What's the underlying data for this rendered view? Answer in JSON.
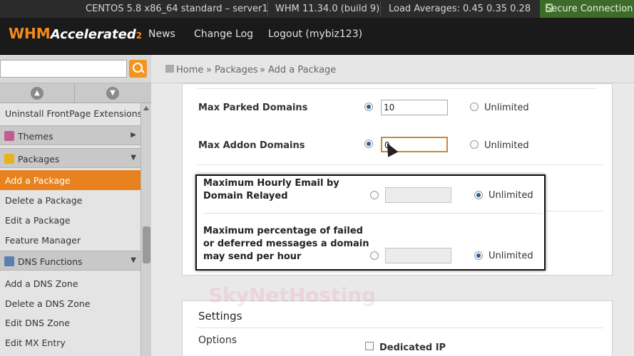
{
  "topbar": {
    "os": "CENTOS 5.8 x86_64 standard – server1",
    "version": "WHM 11.34.0 (build 9)",
    "load": "Load Averages: 0.45 0.35 0.28",
    "secure": "Secure Connection"
  },
  "header": {
    "logo_whm": "WHM",
    "logo_accel": "Accelerated",
    "logo_two": "2",
    "nav": [
      "News",
      "Change Log",
      "Logout (mybiz123)"
    ]
  },
  "breadcrumb": [
    "Home",
    "»",
    "Packages",
    "»",
    "Add a Package"
  ],
  "sidebar": {
    "items": [
      {
        "label": "Uninstall FrontPage Extensions"
      },
      {
        "label": "Themes"
      },
      {
        "label": "Packages"
      },
      {
        "label": "Add a Package"
      },
      {
        "label": "Delete a Package"
      },
      {
        "label": "Edit a Package"
      },
      {
        "label": "Feature Manager"
      },
      {
        "label": "DNS Functions"
      },
      {
        "label": "Add a DNS Zone"
      },
      {
        "label": "Delete a DNS Zone"
      },
      {
        "label": "Edit DNS Zone"
      },
      {
        "label": "Edit MX Entry"
      }
    ]
  },
  "form": {
    "parked_label": "Max Parked Domains",
    "parked_value": "10",
    "addon_label": "Max Addon Domains",
    "addon_value": "0",
    "unlimited": "Unlimited",
    "hourly_line1": "Maximum Hourly Email by",
    "hourly_line2": "Domain Relayed",
    "failed_line1": "Maximum percentage of failed",
    "failed_line2": "or deferred messages a domain",
    "failed_line3": "may send per hour"
  },
  "settings": {
    "title": "Settings",
    "options_label": "Options",
    "dedicated_ip": "Dedicated IP"
  },
  "watermark": "SkyNetHosting"
}
